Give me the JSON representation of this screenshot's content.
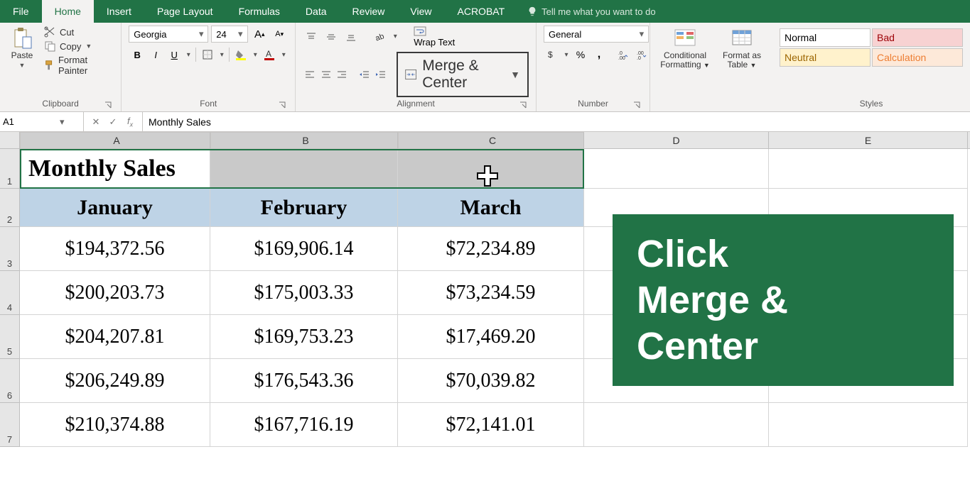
{
  "tabs": {
    "file": "File",
    "home": "Home",
    "insert": "Insert",
    "page_layout": "Page Layout",
    "formulas": "Formulas",
    "data": "Data",
    "review": "Review",
    "view": "View",
    "acrobat": "ACROBAT",
    "tell_me": "Tell me what you want to do"
  },
  "ribbon": {
    "clipboard": {
      "label": "Clipboard",
      "paste": "Paste",
      "cut": "Cut",
      "copy": "Copy",
      "format_painter": "Format Painter"
    },
    "font": {
      "label": "Font",
      "name": "Georgia",
      "size": "24"
    },
    "alignment": {
      "label": "Alignment",
      "wrap": "Wrap Text",
      "merge": "Merge & Center"
    },
    "number": {
      "label": "Number",
      "format": "General"
    },
    "cond": "Conditional Formatting",
    "fmt_table": "Format as Table",
    "styles": {
      "label": "Styles",
      "normal": "Normal",
      "bad": "Bad",
      "neutral": "Neutral",
      "calc": "Calculation"
    }
  },
  "formula_bar": {
    "cell_ref": "A1",
    "formula": "Monthly Sales"
  },
  "columns": [
    "A",
    "B",
    "C",
    "D",
    "E"
  ],
  "rows": [
    "1",
    "2",
    "3",
    "4",
    "5",
    "6",
    "7"
  ],
  "sheet": {
    "title": "Monthly Sales",
    "headers": [
      "January",
      "February",
      "March"
    ],
    "data": [
      [
        "$194,372.56",
        "$169,906.14",
        "$72,234.89"
      ],
      [
        "$200,203.73",
        "$175,003.33",
        "$73,234.59"
      ],
      [
        "$204,207.81",
        "$169,753.23",
        "$17,469.20"
      ],
      [
        "$206,249.89",
        "$176,543.36",
        "$70,039.82"
      ],
      [
        "$210,374.88",
        "$167,716.19",
        "$72,141.01"
      ]
    ]
  },
  "callout": "Click\nMerge &\nCenter",
  "col_widths": {
    "A": 268,
    "B": 264,
    "C": 262,
    "D": 260,
    "E": 280
  }
}
